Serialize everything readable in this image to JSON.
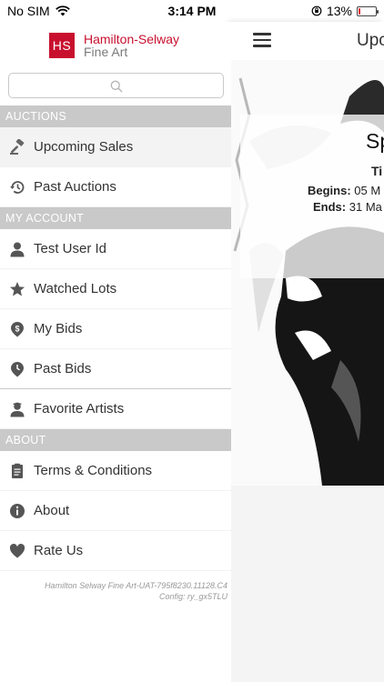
{
  "status": {
    "carrier": "No SIM",
    "time": "3:14 PM",
    "battery": "13%",
    "battery_level": 0.13
  },
  "brand": {
    "logo": "HS",
    "name": "Hamilton-Selway",
    "sub": "Fine Art"
  },
  "search": {
    "placeholder": ""
  },
  "sections": {
    "auctions": "AUCTIONS",
    "account": "MY ACCOUNT",
    "about": "ABOUT"
  },
  "menu": {
    "upcoming": "Upcoming Sales",
    "past_auctions": "Past Auctions",
    "user": "Test User Id",
    "watched": "Watched Lots",
    "my_bids": "My Bids",
    "past_bids": "Past Bids",
    "favorite_artists": "Favorite Artists",
    "terms": "Terms & Conditions",
    "about": "About",
    "rate": "Rate Us"
  },
  "footer": {
    "build": "Hamilton Selway Fine Art-UAT-795f8230.11128.C4",
    "config": "Config: ry_gx5TLU"
  },
  "main": {
    "nav_title": "Upc",
    "sale_title": "Sp",
    "sale_sub": "Ti",
    "begins_label": "Begins:",
    "begins_value": "05 M",
    "ends_label": "Ends:",
    "ends_value": "31 Ma"
  },
  "colors": {
    "brand_red": "#c8102e",
    "section_gray": "#c9c9c9"
  }
}
